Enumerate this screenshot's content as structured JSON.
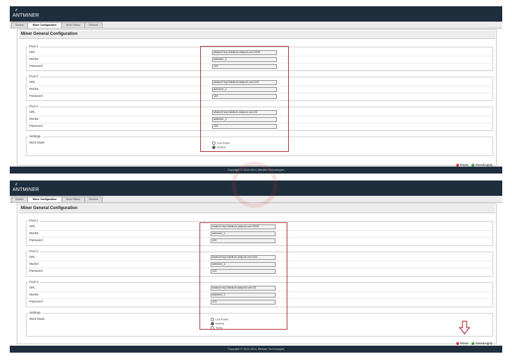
{
  "app": {
    "logo_text": "ANTMINER",
    "tabs": [
      "System",
      "Miner Configuration",
      "Miner Status",
      "Network"
    ],
    "page_title": "Miner General Configuration",
    "copyright": "Copyright © 2013-2014, Bitmain Technologies"
  },
  "pools": [
    {
      "legend": "Pool 1",
      "url_label": "URL",
      "worker_label": "Worker",
      "password_label": "Password",
      "url": "stratum+tcp://stratum.antpool.com:3333",
      "worker": "antminer_1",
      "password": "123"
    },
    {
      "legend": "Pool 2",
      "url_label": "URL",
      "worker_label": "Worker",
      "password_label": "Password",
      "url": "stratum+tcp://stratum.antpool.com:443",
      "worker": "antminer_1",
      "password": "123"
    },
    {
      "legend": "Pool 3",
      "url_label": "URL",
      "worker_label": "Worker",
      "password_label": "Password",
      "url": "stratum+tcp://stratum.antpool.com:25",
      "worker": "antminer_1",
      "password": "123"
    }
  ],
  "settings": {
    "legend": "Settings",
    "work_mode_label": "Work Mode",
    "screen1_modes": [
      "Low Power",
      "Normal"
    ],
    "screen2_modes": [
      "Low Power",
      "Normal",
      "Turbo"
    ],
    "selected": "Normal"
  },
  "buttons": {
    "reset_label": "Reset",
    "save_label": "Save&Apply"
  },
  "colors": {
    "header_bg": "#1f2e3d",
    "highlight": "#b0333a"
  }
}
